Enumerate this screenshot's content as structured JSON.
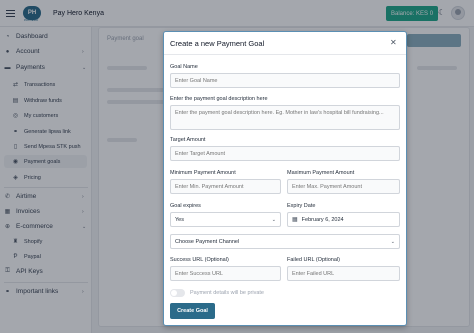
{
  "header": {
    "logo_text": "PH",
    "logo_sub": "PAYHERO",
    "brand": "Pay Hero Kenya",
    "balance": "Balance: KES 0",
    "theme_icon": "moon-icon",
    "avatar_icon": "user-avatar"
  },
  "sidebar": {
    "items": [
      {
        "label": "Dashboard",
        "icon": "dashboard-icon"
      },
      {
        "label": "Account",
        "icon": "user-icon"
      },
      {
        "label": "Payments",
        "icon": "payments-icon"
      },
      {
        "label": "Transactions",
        "icon": "transactions-icon"
      },
      {
        "label": "Withdraw funds",
        "icon": "withdraw-icon"
      },
      {
        "label": "My customers",
        "icon": "customers-icon"
      },
      {
        "label": "Generate lipwa link",
        "icon": "link-icon"
      },
      {
        "label": "Send Mpesa STK push",
        "icon": "phone-icon"
      },
      {
        "label": "Payment goals",
        "icon": "goal-icon"
      },
      {
        "label": "Pricing",
        "icon": "pricing-icon"
      },
      {
        "label": "Airtime",
        "icon": "airtime-icon"
      },
      {
        "label": "Invoices",
        "icon": "invoice-icon"
      },
      {
        "label": "E-commerce",
        "icon": "ecommerce-icon"
      },
      {
        "label": "Shopify",
        "icon": "shopify-icon"
      },
      {
        "label": "Paypal",
        "icon": "paypal-icon"
      },
      {
        "label": "API Keys",
        "icon": "key-icon"
      },
      {
        "label": "Important links",
        "icon": "links-icon"
      }
    ]
  },
  "background": {
    "title": "Payment goal"
  },
  "modal": {
    "title": "Create a new Payment Goal",
    "close_icon": "close-icon",
    "goal_name_label": "Goal Name",
    "goal_name_placeholder": "Enter Goal Name",
    "description_label": "Enter the payment goal description here",
    "description_placeholder": "Enter the payment goal description here. Eg. Mother in law's hospital bill fundraising...",
    "target_label": "Target Amount",
    "target_placeholder": "Enter Target Amount",
    "min_label": "Minimum Payment Amount",
    "min_placeholder": "Enter Min. Payment Amount",
    "max_label": "Maximum Payment Amount",
    "max_placeholder": "Enter Max. Payment Amount",
    "expires_label": "Goal expires",
    "expires_value": "Yes",
    "expiry_date_label": "Expiry Date",
    "expiry_date_value": "February 6, 2024",
    "channel_value": "Choose Payment Channel",
    "success_label": "Success URL (Optional)",
    "success_placeholder": "Enter Success URL",
    "failed_label": "Failed URL (Optional)",
    "failed_placeholder": "Enter Failed URL",
    "private_label": "Payment details will be private",
    "private_enabled": false,
    "submit_label": "Create Goal"
  },
  "colors": {
    "accent": "#2b6b8a",
    "balance_bg": "#1fa889",
    "modal_border": "#5b8fb3"
  }
}
